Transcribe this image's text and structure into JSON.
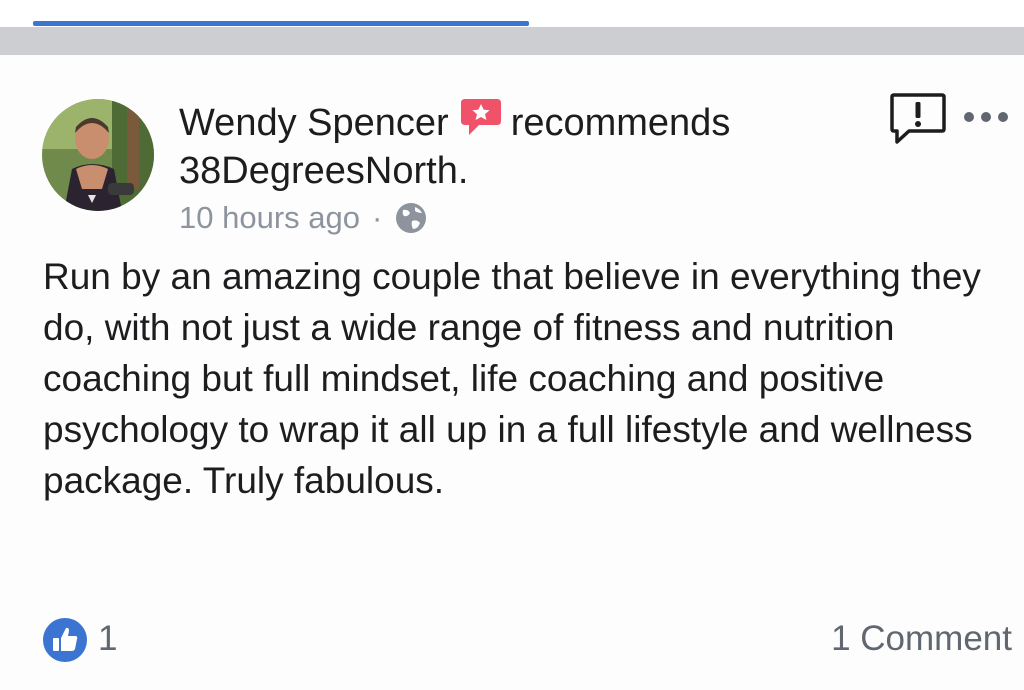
{
  "post": {
    "author_name": "Wendy Spencer",
    "action_text": "recommends",
    "page_name": "38DegreesNorth.",
    "timestamp": "10 hours ago",
    "separator": "·",
    "privacy_icon": "globe-icon",
    "body": "Run by an amazing couple that believe in everything they do, with not just a wide range of fitness and nutrition coaching but full mindset, life coaching and positive psychology to wrap it all up in a full lifestyle and wellness package. Truly fabulous."
  },
  "actions": {
    "report_icon": "report-icon",
    "more_icon": "more-options-icon"
  },
  "footer": {
    "like_count": "1",
    "comments_label": "1 Comment"
  },
  "colors": {
    "accent_blue": "#3b74d1",
    "recommend_red": "#f0526a",
    "meta_gray": "#8d949e"
  }
}
